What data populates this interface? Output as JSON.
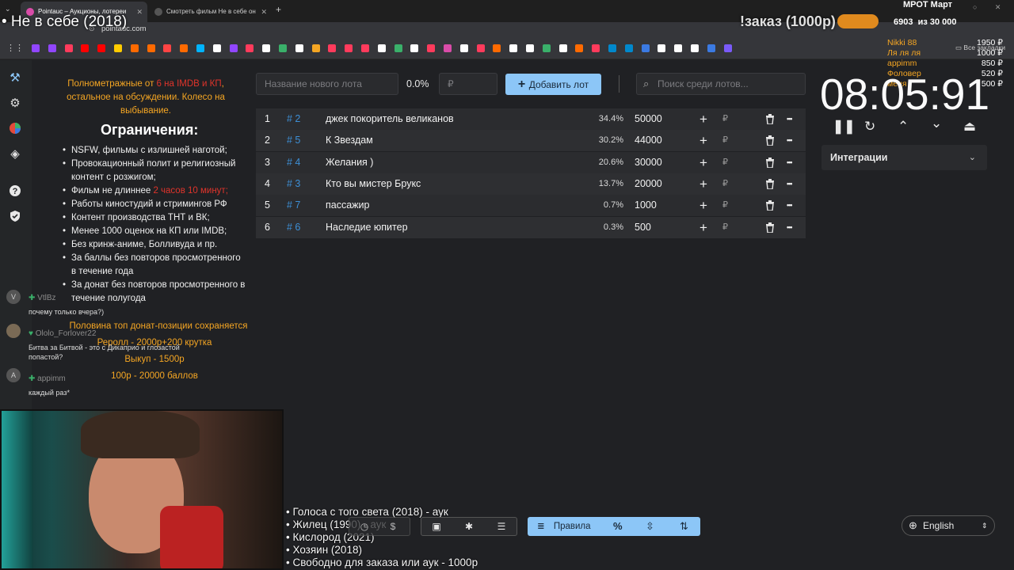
{
  "browser": {
    "tabs": [
      {
        "title": "Pointauc – Аукционы, лотереи",
        "active": true
      },
      {
        "title": "Смотреть фильм Не в себе он",
        "active": false
      }
    ],
    "address": "pointauc.com",
    "bookmarks_all_label": "Все закладки"
  },
  "stream_overlay": {
    "title": "• Не в себе (2018)",
    "order_label": "!заказ (1000р)",
    "goal_title": "МРОТ Март",
    "goal_progress": "6903  из 30 000",
    "donors": [
      "Nikki 88",
      "Ля ля ля",
      "appimm",
      "Фоловер",
      "меня"
    ],
    "amounts": [
      "1950 ₽",
      "1000 ₽",
      "850 ₽",
      "520 ₽",
      "500 ₽"
    ],
    "film_list": [
      "• Голоса с того света (2018) - аук",
      "• Жилец (1990) - аук",
      "• Кислород (2021)",
      "• Хозяин (2018)",
      "• Свободно для заказа или аук - 1000р"
    ]
  },
  "rules": {
    "intro_a": "Полнометражные от ",
    "intro_red": "6 на IMDB и КП",
    "intro_b": ", остальное на обсуждении. Колесо на выбывание.",
    "heading": "Ограничения:",
    "items": [
      "NSFW, фильмы с излишней наготой;",
      "Провокационный полит и религиозный контент с розжигом;",
      "Фильм не длиннее ",
      "Работы киностудий и стримингов РФ",
      "Контент производства ТНТ и ВК;",
      "Менее 1000 оценок на КП или IMDB;",
      "Без кринж-аниме, Болливуда и пр.",
      "За баллы без повторов просмотренного в течение года",
      "За донат без повторов просмотренного в течение полугода"
    ],
    "duration_red": "2 часов 10 минут;",
    "footer": [
      "Половина топ донат-позиции сохраняется",
      "Реролл - 2000р+200 крутка",
      "Выкуп - 1500р",
      "100р - 20000 баллов"
    ]
  },
  "lot_form": {
    "name_placeholder": "Название нового лота",
    "percent": "0.0%",
    "amount_placeholder": "₽",
    "add_button": "Добавить лот",
    "search_placeholder": "Поиск среди лотов..."
  },
  "lots": [
    {
      "pos": "1",
      "id": "# 2",
      "name": "джек покоритель великанов",
      "percent": "34.4%",
      "amount": "50000"
    },
    {
      "pos": "2",
      "id": "# 5",
      "name": "К Звездам",
      "percent": "30.2%",
      "amount": "44000"
    },
    {
      "pos": "3",
      "id": "# 4",
      "name": "Желания )",
      "percent": "20.6%",
      "amount": "30000"
    },
    {
      "pos": "4",
      "id": "# 3",
      "name": "Кто вы мистер Брукс",
      "percent": "13.7%",
      "amount": "20000"
    },
    {
      "pos": "5",
      "id": "# 7",
      "name": "пассажир",
      "percent": "0.7%",
      "amount": "1000"
    },
    {
      "pos": "6",
      "id": "# 6",
      "name": "Наследие юпитер",
      "percent": "0.3%",
      "amount": "500"
    }
  ],
  "lot_currency": "₽",
  "timer": "08:05:91",
  "integrations_label": "Интеграции",
  "chat": [
    {
      "avatar": "V",
      "name": "VtlBz",
      "message": "почему только вчера?)"
    },
    {
      "avatar": "",
      "name": "Ololo_Forlover22",
      "message": "Битва за Битвой - это с Дикаприо и глозастой попастой?"
    },
    {
      "avatar": "A",
      "name": "appimm",
      "message": "каждый  раз*"
    }
  ],
  "bottom_bar": {
    "rules_label": "Правила",
    "percent_icon": "%",
    "language": "English"
  },
  "colors": {
    "accent": "#8cc6f7",
    "lot_id": "#3d8fd6",
    "orange": "#f5a623",
    "red": "#e0342b"
  }
}
